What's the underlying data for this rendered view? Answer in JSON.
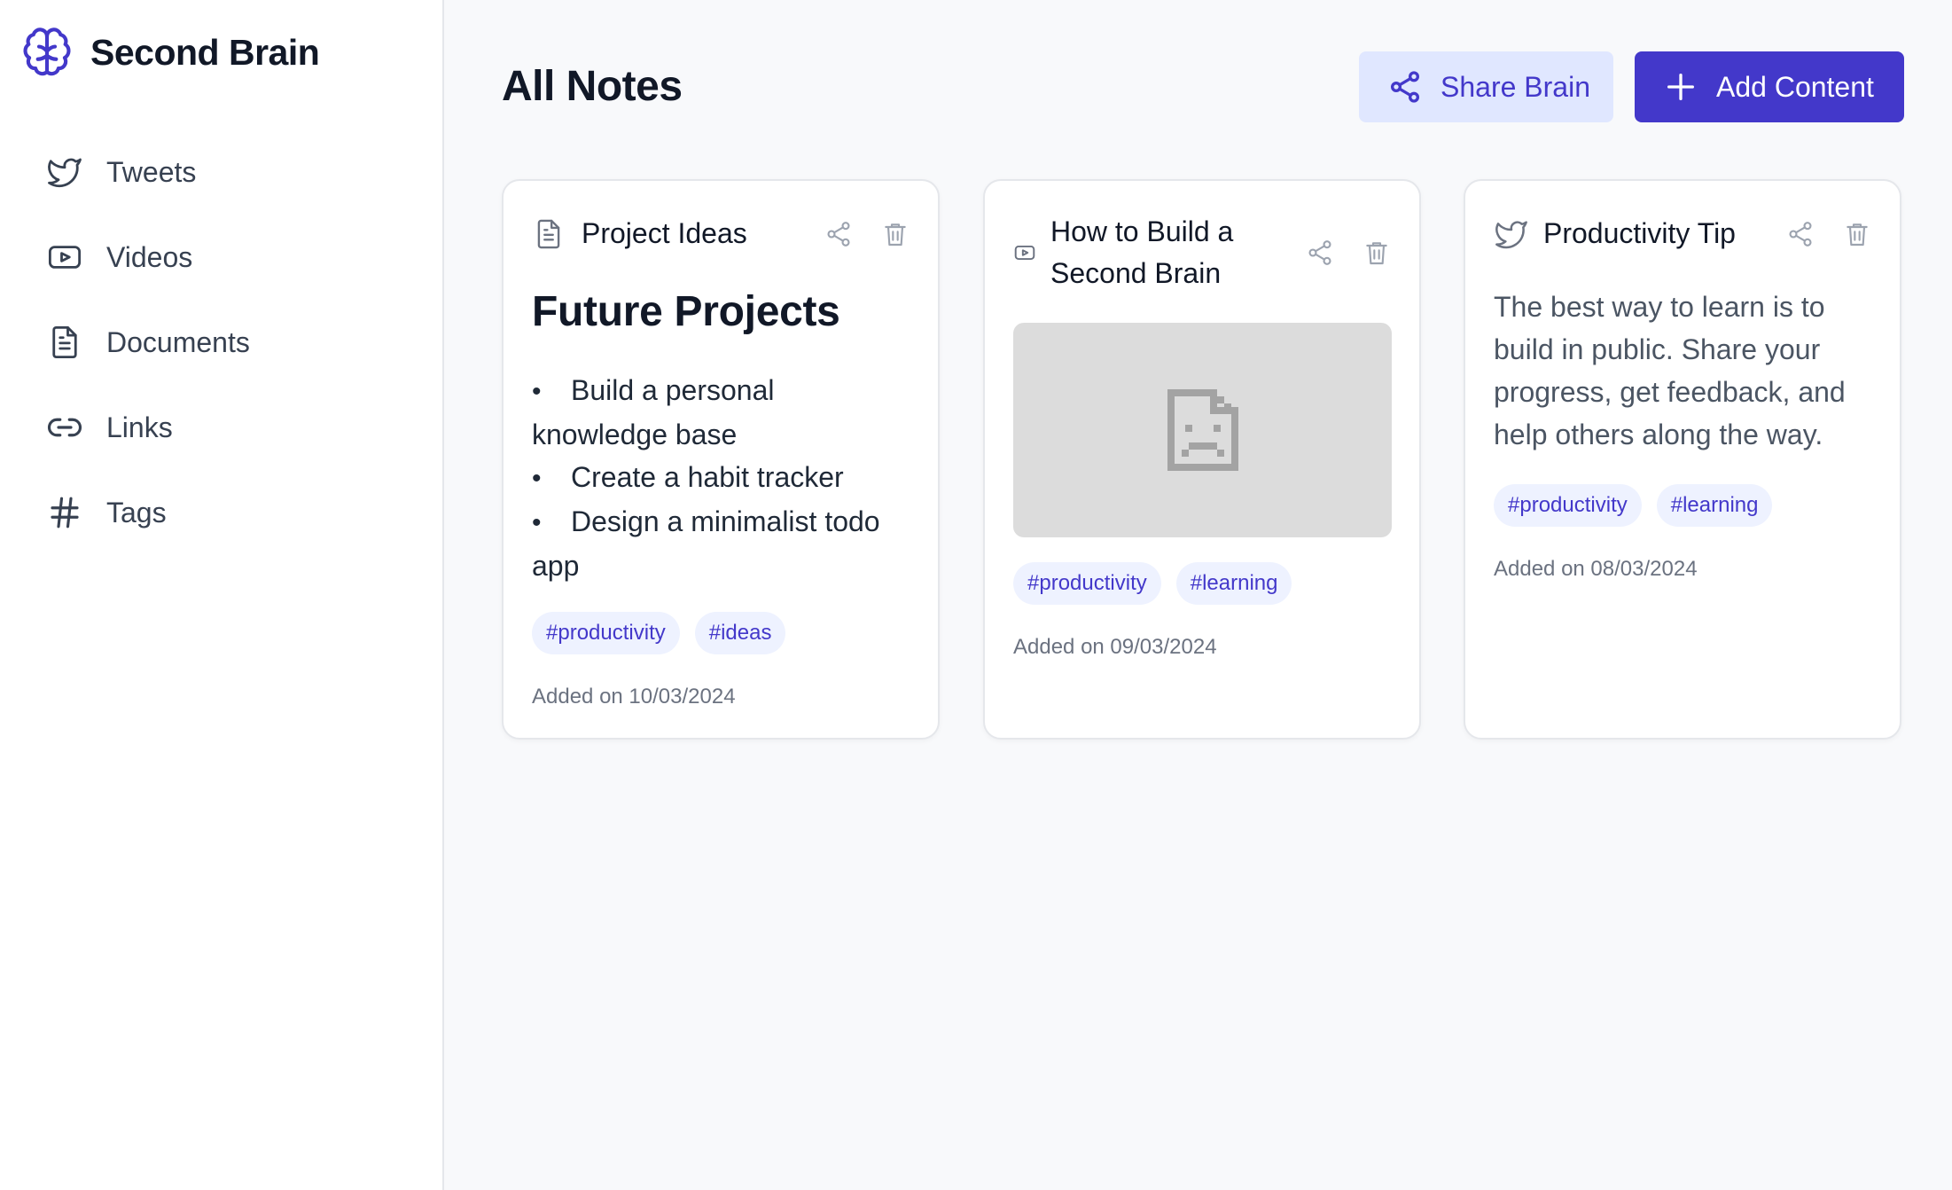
{
  "app": {
    "name": "Second Brain",
    "logo_icon": "brain-icon",
    "accent_color": "#4338ca"
  },
  "sidebar": {
    "items": [
      {
        "label": "Tweets",
        "icon": "twitter-icon"
      },
      {
        "label": "Videos",
        "icon": "youtube-icon"
      },
      {
        "label": "Documents",
        "icon": "document-icon"
      },
      {
        "label": "Links",
        "icon": "link-icon"
      },
      {
        "label": "Tags",
        "icon": "hash-icon"
      }
    ]
  },
  "header": {
    "title": "All Notes",
    "share_label": "Share Brain",
    "add_label": "Add Content"
  },
  "cards": [
    {
      "type_icon": "document-icon",
      "title": "Project Ideas",
      "heading": "Future Projects",
      "bullets": [
        "Build a personal knowledge base",
        "Create a habit tracker",
        "Design a minimalist todo app"
      ],
      "tags": [
        "#productivity",
        "#ideas"
      ],
      "added": "Added on 10/03/2024"
    },
    {
      "type_icon": "youtube-icon",
      "title": "How to Build a Second Brain",
      "embed_icon": "broken-file-icon",
      "tags": [
        "#productivity",
        "#learning"
      ],
      "added": "Added on 09/03/2024"
    },
    {
      "type_icon": "twitter-icon",
      "title": "Productivity Tip",
      "text": "The best way to learn is to build in public. Share your progress, get feedback, and help others along the way.",
      "tags": [
        "#productivity",
        "#learning"
      ],
      "added": "Added on 08/03/2024"
    }
  ]
}
